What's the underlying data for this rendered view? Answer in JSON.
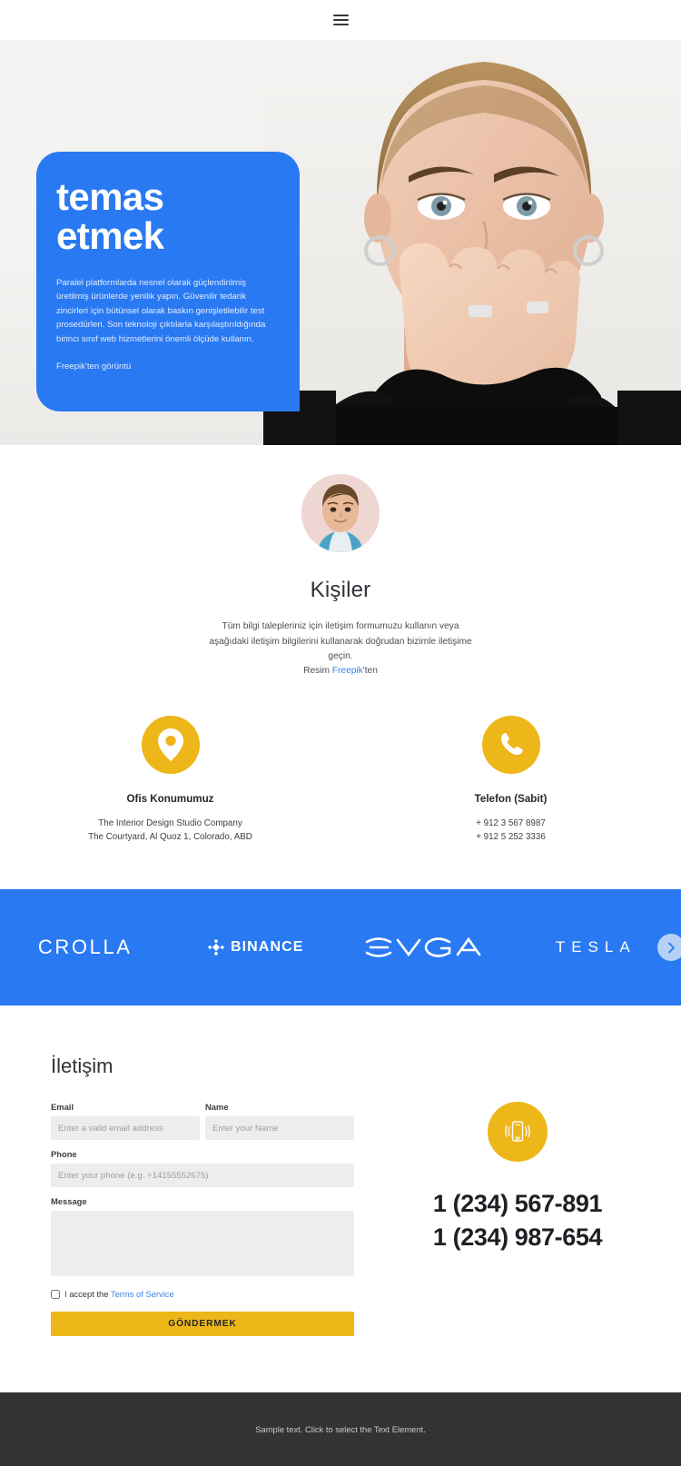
{
  "topbar": {
    "menu_icon": "hamburger-menu-icon"
  },
  "hero": {
    "title_line1": "temas",
    "title_line2": "etmek",
    "body": "Paralel platformlarda nesnel olarak güçlendirilmiş üretilmiş ürünlerde yenilik yapın. Güvenilir tedarik zincirleri için bütünsel olarak baskın genişletilebilir test prosedürleri. Son teknoloji çıktılarla karşılaştırıldığında birinci sınıf web hizmetlerini önemli ölçüde kullanın.",
    "credit": "Freepik'ten görüntü",
    "card_color": "#2979f2"
  },
  "contacts": {
    "avatar_alt": "avatar",
    "heading": "Kişiler",
    "description": "Tüm bilgi talepleriniz için iletişim formumuzu kullanın veya aşağıdaki iletişim bilgilerini kullanarak doğrudan bizimle iletişime geçin.",
    "credit_prefix": "Resim ",
    "credit_link": "Freepik",
    "credit_suffix": "'ten",
    "cards": [
      {
        "icon": "location-pin-icon",
        "title": "Ofis Konumumuz",
        "line1": "The Interior Design Studio Company",
        "line2": "The Courtyard, Al Quoz 1, Colorado,  ABD"
      },
      {
        "icon": "phone-handset-icon",
        "title": "Telefon (Sabit)",
        "line1": "+ 912 3 567 8987",
        "line2": "+ 912 5 252 3336"
      }
    ]
  },
  "brands": {
    "background": "#2979f2",
    "items": [
      {
        "name": "CROLLA",
        "icon": "crolla-logo"
      },
      {
        "name": "BINANCE",
        "icon": "binance-logo"
      },
      {
        "name": "EVGA",
        "icon": "evga-logo"
      },
      {
        "name": "TESLA",
        "icon": "tesla-logo"
      }
    ],
    "next_icon": "chevron-right-icon"
  },
  "form": {
    "title": "İletişim",
    "email_label": "Email",
    "email_placeholder": "Enter a valid email address",
    "email_value": "",
    "name_label": "Name",
    "name_placeholder": "Enter your Name",
    "name_value": "",
    "phone_label": "Phone",
    "phone_placeholder": "Enter your phone (e.g. +14155552675)",
    "phone_value": "",
    "message_label": "Message",
    "message_placeholder": "",
    "message_value": "",
    "tos_prefix": "I accept the ",
    "tos_link": "Terms of Service",
    "submit_label": "GÖNDERMEK",
    "submit_color": "#edb619"
  },
  "contact_right": {
    "icon": "mobile-vibrate-icon",
    "phone1": "1 (234) 567-891",
    "phone2": "1 (234) 987-654"
  },
  "footer": {
    "text": "Sample text. Click to select the Text Element."
  }
}
